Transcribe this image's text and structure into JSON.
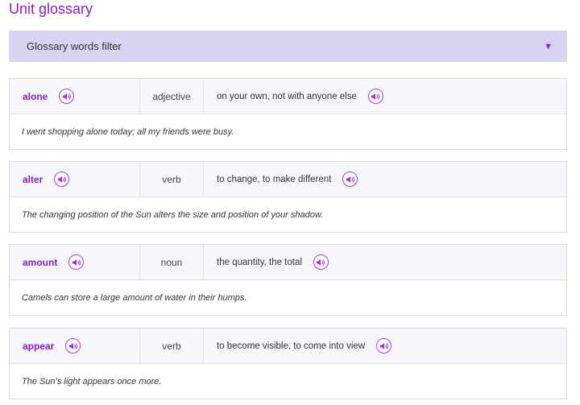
{
  "page": {
    "title": "Unit glossary"
  },
  "filter": {
    "label": "Glossary words filter",
    "arrow_icon": "triangle-down-icon",
    "arrow_glyph": "▼"
  },
  "entries": [
    {
      "word": "alone",
      "pos": "adjective",
      "definition": "on your own, not with anyone else",
      "example": "I went shopping alone today; all my friends were busy."
    },
    {
      "word": "alter",
      "pos": "verb",
      "definition": "to change, to make different",
      "example": "The changing position of the Sun alters the size and position of your shadow."
    },
    {
      "word": "amount",
      "pos": "noun",
      "definition": "the quantity, the total",
      "example": "Camels can store a large amount of water in their humps."
    },
    {
      "word": "appear",
      "pos": "verb",
      "definition": "to become visible, to come into view",
      "example": "The Sun’s light appears once more."
    }
  ],
  "colors": {
    "accent": "#8a1fbf",
    "filter_bg": "#d9d2f3",
    "row_bg": "#f6f6fd"
  },
  "icons": {
    "audio": "speaker-icon"
  }
}
